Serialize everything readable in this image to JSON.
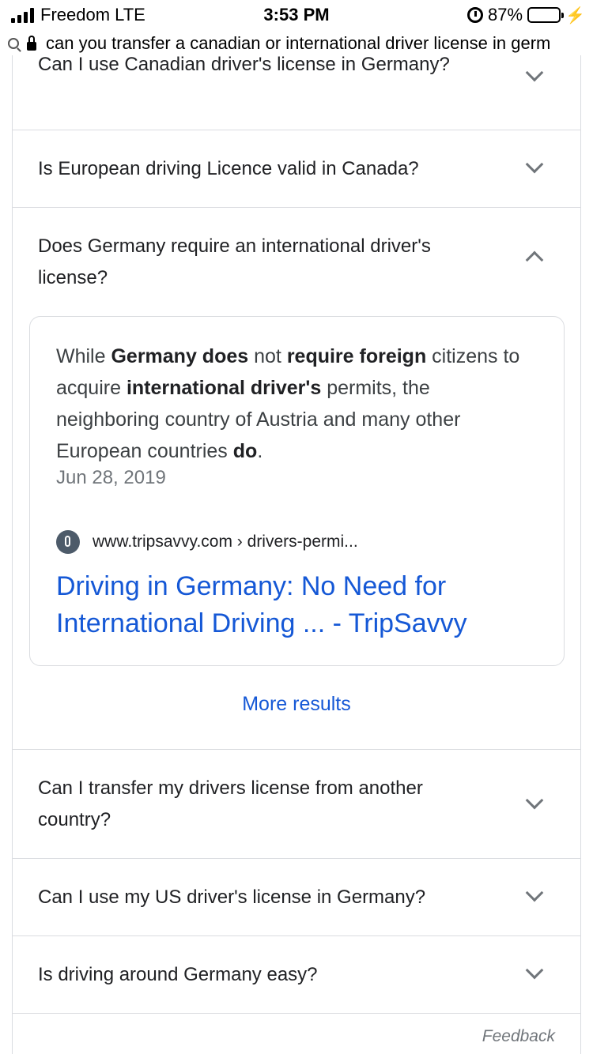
{
  "status_bar": {
    "carrier": "Freedom  LTE",
    "time": "3:53 PM",
    "battery_pct": "87%",
    "battery_level": 0.87,
    "battery_color": "#4cd964"
  },
  "url_bar": {
    "url": "can you transfer a canadian or international driver license in germ"
  },
  "faq": {
    "q_partial": "Can I use Canadian driver's license in Germany?",
    "q1": "Is European driving Licence valid in Canada?",
    "q2": "Does Germany require an international driver's license?",
    "answer": {
      "t1": "While ",
      "b1": "Germany does",
      "t2": " not ",
      "b2": "require foreign",
      "t3": " citizens to acquire ",
      "b3": "international driver's",
      "t4": " permits, the neighboring country of Austria and many other European countries ",
      "b4": "do",
      "t5": ".",
      "date": "Jun 28, 2019",
      "source_url": "www.tripsavvy.com › drivers-permi...",
      "source_title": "Driving in Germany: No Need for International Driving ... - TripSavvy"
    },
    "more_results": "More results",
    "q3": "Can I transfer my drivers license from another country?",
    "q4": "Can I use my US driver's license in Germany?",
    "q5": "Is driving around Germany easy?"
  },
  "feedback": "Feedback",
  "icons": [
    "signal-icon",
    "alarm-icon",
    "battery-icon",
    "charging-icon",
    "search-icon",
    "lock-icon",
    "chevron-down-icon",
    "chevron-up-icon",
    "tripsavvy-favicon-icon"
  ],
  "colors": {
    "link": "#1558d6",
    "divider": "#dadce0",
    "muted": "#70757a"
  }
}
